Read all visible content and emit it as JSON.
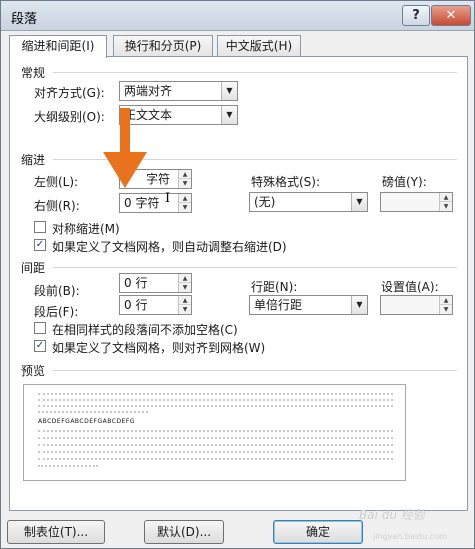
{
  "window": {
    "title": "段落"
  },
  "titlebar": {
    "help": "?",
    "close": "✕"
  },
  "tabs": [
    {
      "label": "缩进和间距(I)"
    },
    {
      "label": "换行和分页(P)"
    },
    {
      "label": "中文版式(H)"
    }
  ],
  "general": {
    "heading": "常规",
    "alignment_label": "对齐方式(G):",
    "alignment_value": "两端对齐",
    "outline_label": "大纲级别(O):",
    "outline_value": "正文文本"
  },
  "indent": {
    "heading": "缩进",
    "left_label": "左侧(L):",
    "left_value": "字符",
    "right_label": "右侧(R):",
    "right_value": "0 字符",
    "special_label": "特殊格式(S):",
    "special_value": "(无)",
    "by_label": "磅值(Y):",
    "by_value": "",
    "mirror_label": "对称缩进(M)",
    "mirror_checked": false,
    "auto_adjust_label": "如果定义了文档网格，则自动调整右缩进(D)",
    "auto_adjust_checked": true
  },
  "spacing": {
    "heading": "间距",
    "before_label": "段前(B):",
    "before_value": "0 行",
    "after_label": "段后(F):",
    "after_value": "0 行",
    "line_label": "行距(N):",
    "line_value": "单倍行距",
    "at_label": "设置值(A):",
    "at_value": "",
    "no_space_label": "在相同样式的段落间不添加空格(C)",
    "no_space_checked": false,
    "snap_grid_label": "如果定义了文档网格，则对齐到网格(W)",
    "snap_grid_checked": true
  },
  "preview": {
    "heading": "预览",
    "sample_text": "ABCDEFGABCDEFGABCDEFG"
  },
  "buttons": {
    "tabs": "制表位(T)...",
    "default": "默认(D)...",
    "ok": "确定"
  },
  "watermark": {
    "text": "Bai du 经验",
    "url": "jingyan.baidu.com"
  },
  "colors": {
    "arrow": "#e8731c",
    "dialog_bg": "#f0f0f0"
  }
}
